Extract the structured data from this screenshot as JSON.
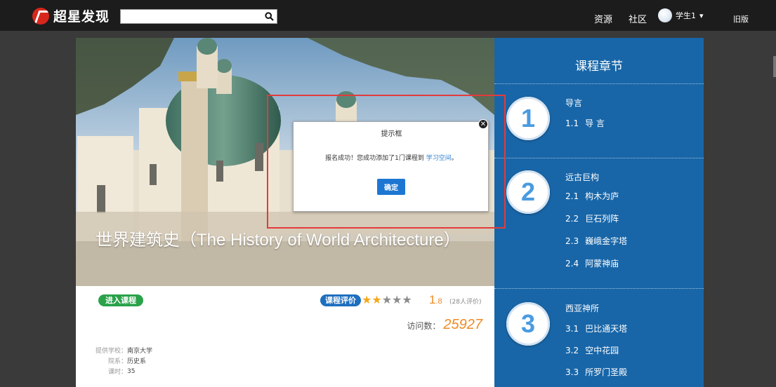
{
  "header": {
    "logo_text": "超星发现",
    "search_value": "",
    "nav": {
      "resources": "资源",
      "community": "社区",
      "old_version": "旧版"
    },
    "user": {
      "name": "学生1"
    }
  },
  "course": {
    "title": "世界建筑史（The History of World Architecture）",
    "enter_label": "进入课程",
    "rating_label": "课程评价",
    "rating": {
      "score_main": "1",
      "score_decimal": ".8",
      "count_text": "(28人评价)",
      "stars_filled": 2,
      "stars_total": 5
    },
    "visits_label": "访问数：",
    "visits_value": "25927",
    "meta": [
      {
        "label": "提供学校：",
        "value": "南京大学"
      },
      {
        "label": "院系：",
        "value": "历史系"
      },
      {
        "label": "课时：",
        "value": "35"
      }
    ]
  },
  "chapters": {
    "heading": "课程章节",
    "sections": [
      {
        "number": "1",
        "title": "导言",
        "items": [
          {
            "num": "1.1",
            "label": "导 言"
          }
        ]
      },
      {
        "number": "2",
        "title": "远古巨构",
        "items": [
          {
            "num": "2.1",
            "label": "构木为庐"
          },
          {
            "num": "2.2",
            "label": "巨石列阵"
          },
          {
            "num": "2.3",
            "label": "巍峨金字塔"
          },
          {
            "num": "2.4",
            "label": "阿蒙神庙"
          }
        ]
      },
      {
        "number": "3",
        "title": "西亚神所",
        "items": [
          {
            "num": "3.1",
            "label": "巴比通天塔"
          },
          {
            "num": "3.2",
            "label": "空中花园"
          },
          {
            "num": "3.3",
            "label": "所罗门圣殿"
          }
        ]
      }
    ]
  },
  "modal": {
    "title": "提示框",
    "message": "报名成功！您成功添加了1门课程到",
    "link": "学习空间",
    "message_end": "。",
    "ok_label": "确定"
  },
  "colors": {
    "accent_blue": "#1866a8",
    "green": "#2aa24a",
    "orange": "#f08a24",
    "highlight_red": "#e23b3b"
  }
}
